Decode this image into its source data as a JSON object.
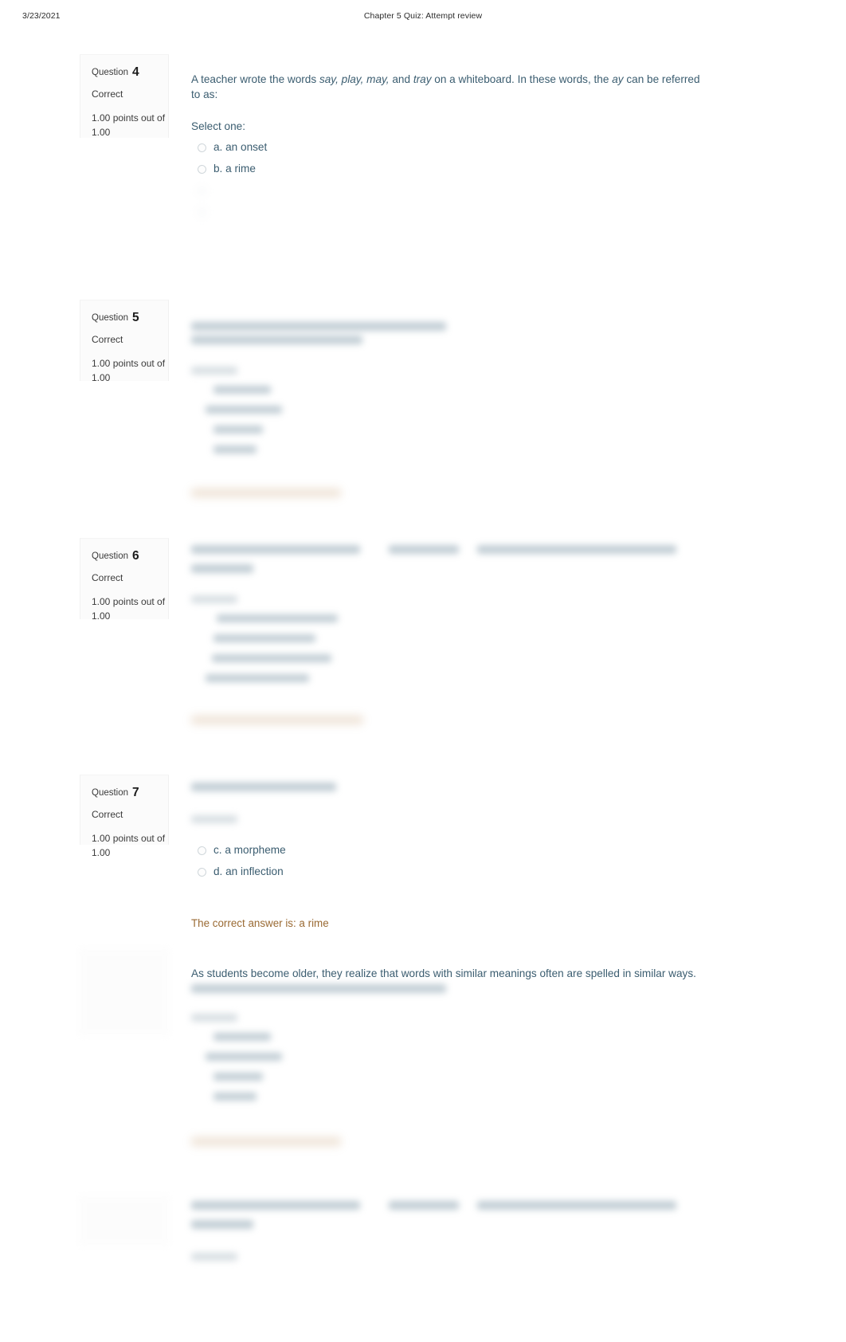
{
  "print_header": {
    "date": "3/23/2021",
    "title": "Chapter 5 Quiz: Attempt review"
  },
  "theme": {
    "question_text_color": "#3b5d70",
    "correct_answer_color": "#9a6a33",
    "info_panel_bg": "#fbfbfb",
    "page_bg": "#ffffff"
  },
  "questions": [
    {
      "number_label": "Question",
      "number": "4",
      "state": "Correct",
      "marks": "1.00 points out of 1.00",
      "text_part1": "A teacher wrote the words ",
      "text_em1": "say, play, may,",
      "text_part2": " and ",
      "text_em2": "tray",
      "text_part3": " on a whiteboard. In these words, the ",
      "text_em3": "ay",
      "text_part4": " can be referred to as:",
      "select_one": "Select one:",
      "options": [
        {
          "label": "a. an onset"
        },
        {
          "label": "b. a rime"
        },
        {
          "label": ""
        },
        {
          "label": ""
        }
      ]
    },
    {
      "number_label": "Question",
      "number": "5",
      "state": "Correct",
      "marks": "1.00 points out of 1.00",
      "redacted": true
    },
    {
      "number_label": "Question",
      "number": "6",
      "state": "Correct",
      "marks": "1.00 points out of 1.00",
      "redacted": true
    },
    {
      "number_label": "Question",
      "number": "7",
      "state": "Correct",
      "marks": "1.00 points out of 1.00",
      "options_visible": [
        {
          "label": "c. a morpheme"
        },
        {
          "label": "d. an inflection"
        }
      ],
      "correct_answer": "The correct answer is: a rime"
    },
    {
      "number_label": "",
      "number": "",
      "state": "",
      "marks": "",
      "text": "As students become older, they realize that words with similar meanings often are spelled in similar ways.",
      "redacted": true
    },
    {
      "number_label": "",
      "number": "",
      "state": "",
      "marks": "",
      "redacted": true
    }
  ]
}
